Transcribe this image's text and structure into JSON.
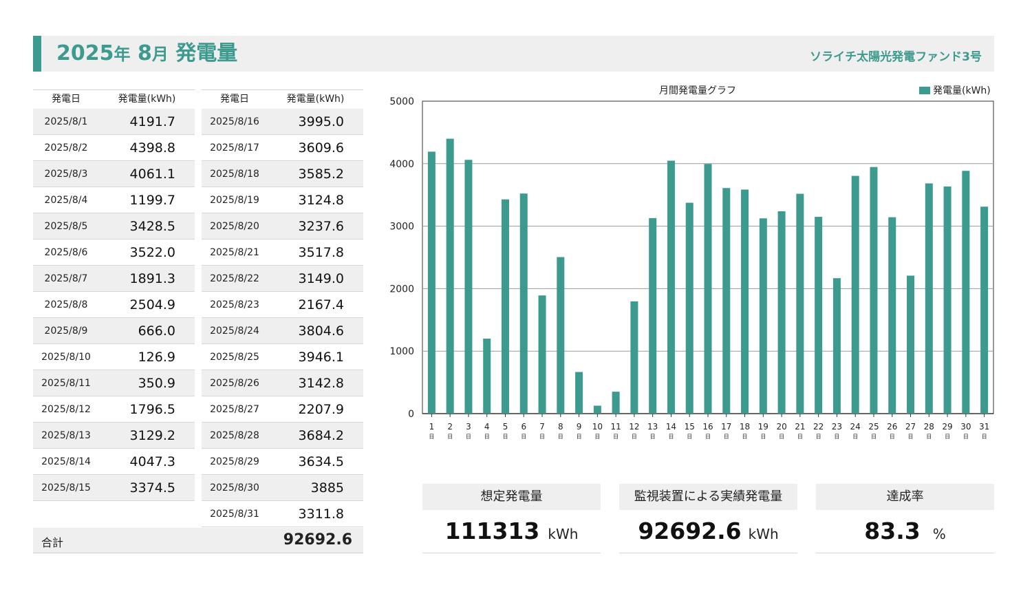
{
  "header": {
    "year": "2025",
    "year_suffix": "年",
    "month": "8",
    "month_suffix": "月",
    "title_label": "発電量",
    "fund_name": "ソライチ太陽光発電ファンド3号"
  },
  "table": {
    "col_date": "発電日",
    "col_value": "発電量(kWh)",
    "left_rows": [
      {
        "date": "2025/8/1",
        "value": "4191.7"
      },
      {
        "date": "2025/8/2",
        "value": "4398.8"
      },
      {
        "date": "2025/8/3",
        "value": "4061.1"
      },
      {
        "date": "2025/8/4",
        "value": "1199.7"
      },
      {
        "date": "2025/8/5",
        "value": "3428.5"
      },
      {
        "date": "2025/8/6",
        "value": "3522.0"
      },
      {
        "date": "2025/8/7",
        "value": "1891.3"
      },
      {
        "date": "2025/8/8",
        "value": "2504.9"
      },
      {
        "date": "2025/8/9",
        "value": "666.0"
      },
      {
        "date": "2025/8/10",
        "value": "126.9"
      },
      {
        "date": "2025/8/11",
        "value": "350.9"
      },
      {
        "date": "2025/8/12",
        "value": "1796.5"
      },
      {
        "date": "2025/8/13",
        "value": "3129.2"
      },
      {
        "date": "2025/8/14",
        "value": "4047.3"
      },
      {
        "date": "2025/8/15",
        "value": "3374.5"
      }
    ],
    "right_rows": [
      {
        "date": "2025/8/16",
        "value": "3995.0"
      },
      {
        "date": "2025/8/17",
        "value": "3609.6"
      },
      {
        "date": "2025/8/18",
        "value": "3585.2"
      },
      {
        "date": "2025/8/19",
        "value": "3124.8"
      },
      {
        "date": "2025/8/20",
        "value": "3237.6"
      },
      {
        "date": "2025/8/21",
        "value": "3517.8"
      },
      {
        "date": "2025/8/22",
        "value": "3149.0"
      },
      {
        "date": "2025/8/23",
        "value": "2167.4"
      },
      {
        "date": "2025/8/24",
        "value": "3804.6"
      },
      {
        "date": "2025/8/25",
        "value": "3946.1"
      },
      {
        "date": "2025/8/26",
        "value": "3142.8"
      },
      {
        "date": "2025/8/27",
        "value": "2207.9"
      },
      {
        "date": "2025/8/28",
        "value": "3684.2"
      },
      {
        "date": "2025/8/29",
        "value": "3634.5"
      },
      {
        "date": "2025/8/30",
        "value": "3885"
      },
      {
        "date": "2025/8/31",
        "value": "3311.8"
      }
    ],
    "total_label": "合計",
    "total_value": "92692.6"
  },
  "summary": {
    "expected_label": "想定発電量",
    "expected_value": "111313",
    "expected_unit": "kWh",
    "actual_label": "監視装置による実績発電量",
    "actual_value": "92692.6",
    "actual_unit": "kWh",
    "rate_label": "達成率",
    "rate_value": "83.3",
    "rate_unit": "%"
  },
  "chart_data": {
    "type": "bar",
    "title": "月間発電量グラフ",
    "legend_position": "top-right",
    "xlabel": "",
    "ylabel": "",
    "ylim": [
      0,
      5000
    ],
    "yticks": [
      0,
      1000,
      2000,
      3000,
      4000,
      5000
    ],
    "grid": true,
    "categories": [
      "1",
      "2",
      "3",
      "4",
      "5",
      "6",
      "7",
      "8",
      "9",
      "10",
      "11",
      "12",
      "13",
      "14",
      "15",
      "16",
      "17",
      "18",
      "19",
      "20",
      "21",
      "22",
      "23",
      "24",
      "25",
      "26",
      "27",
      "28",
      "29",
      "30",
      "31"
    ],
    "category_suffix": "日",
    "series": [
      {
        "name": "発電量(kWh)",
        "color": "#3d9a8e",
        "values": [
          4191.7,
          4398.8,
          4061.1,
          1199.7,
          3428.5,
          3522.0,
          1891.3,
          2504.9,
          666.0,
          126.9,
          350.9,
          1796.5,
          3129.2,
          4047.3,
          3374.5,
          3995.0,
          3609.6,
          3585.2,
          3124.8,
          3237.6,
          3517.8,
          3149.0,
          2167.4,
          3804.6,
          3946.1,
          3142.8,
          2207.9,
          3684.2,
          3634.5,
          3885,
          3311.8
        ]
      }
    ]
  }
}
